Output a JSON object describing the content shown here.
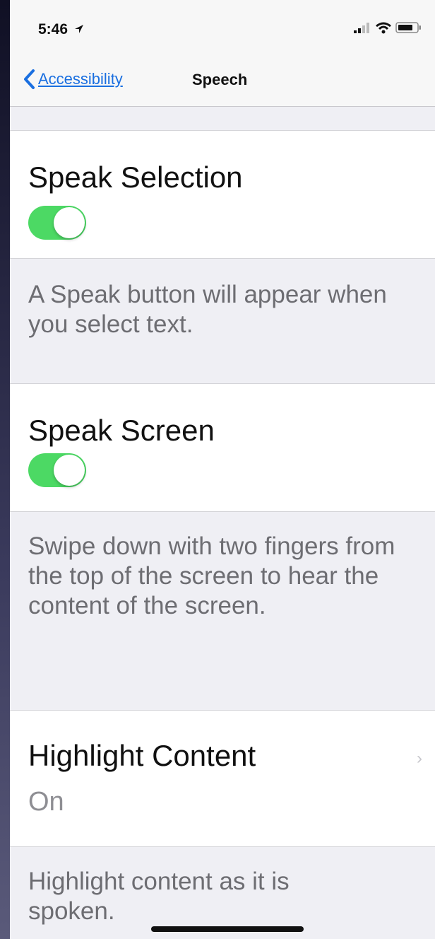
{
  "status_bar": {
    "time": "5:46"
  },
  "nav": {
    "back_label": "Accessibility",
    "title": "Speech"
  },
  "speak_selection": {
    "title": "Speak Selection",
    "enabled": true,
    "footer": "A Speak button will appear when you select text."
  },
  "speak_screen": {
    "title": "Speak Screen",
    "enabled": true,
    "footer": "Swipe down with two fingers from the top of the screen to hear the content of the screen."
  },
  "highlight_content": {
    "title": "Highlight Content",
    "value": "On",
    "footer": "Highlight content as it is spoken."
  },
  "colors": {
    "toggle_on": "#4cd964",
    "link_blue": "#1a6fe0",
    "group_background": "#efeff4",
    "footer_gray": "#6d6d72"
  },
  "icons": [
    "location-arrow-icon",
    "cellular-signal-icon",
    "wifi-icon",
    "battery-icon",
    "back-chevron-icon",
    "disclosure-chevron-icon"
  ]
}
